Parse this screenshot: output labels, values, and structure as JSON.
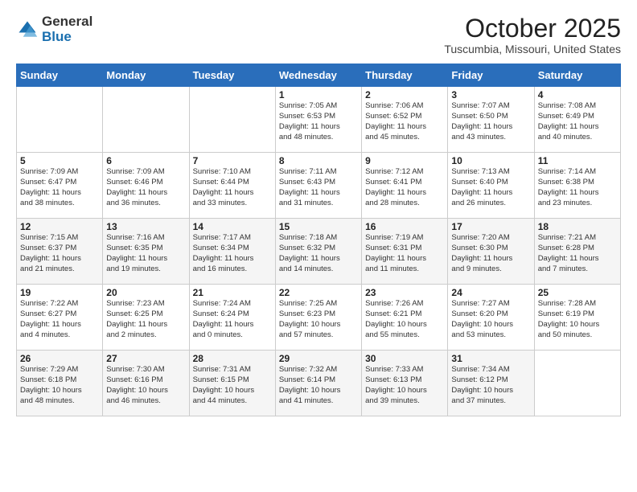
{
  "logo": {
    "general": "General",
    "blue": "Blue"
  },
  "header": {
    "month": "October 2025",
    "location": "Tuscumbia, Missouri, United States"
  },
  "weekdays": [
    "Sunday",
    "Monday",
    "Tuesday",
    "Wednesday",
    "Thursday",
    "Friday",
    "Saturday"
  ],
  "weeks": [
    [
      {
        "day": "",
        "info": ""
      },
      {
        "day": "",
        "info": ""
      },
      {
        "day": "",
        "info": ""
      },
      {
        "day": "1",
        "info": "Sunrise: 7:05 AM\nSunset: 6:53 PM\nDaylight: 11 hours\nand 48 minutes."
      },
      {
        "day": "2",
        "info": "Sunrise: 7:06 AM\nSunset: 6:52 PM\nDaylight: 11 hours\nand 45 minutes."
      },
      {
        "day": "3",
        "info": "Sunrise: 7:07 AM\nSunset: 6:50 PM\nDaylight: 11 hours\nand 43 minutes."
      },
      {
        "day": "4",
        "info": "Sunrise: 7:08 AM\nSunset: 6:49 PM\nDaylight: 11 hours\nand 40 minutes."
      }
    ],
    [
      {
        "day": "5",
        "info": "Sunrise: 7:09 AM\nSunset: 6:47 PM\nDaylight: 11 hours\nand 38 minutes."
      },
      {
        "day": "6",
        "info": "Sunrise: 7:09 AM\nSunset: 6:46 PM\nDaylight: 11 hours\nand 36 minutes."
      },
      {
        "day": "7",
        "info": "Sunrise: 7:10 AM\nSunset: 6:44 PM\nDaylight: 11 hours\nand 33 minutes."
      },
      {
        "day": "8",
        "info": "Sunrise: 7:11 AM\nSunset: 6:43 PM\nDaylight: 11 hours\nand 31 minutes."
      },
      {
        "day": "9",
        "info": "Sunrise: 7:12 AM\nSunset: 6:41 PM\nDaylight: 11 hours\nand 28 minutes."
      },
      {
        "day": "10",
        "info": "Sunrise: 7:13 AM\nSunset: 6:40 PM\nDaylight: 11 hours\nand 26 minutes."
      },
      {
        "day": "11",
        "info": "Sunrise: 7:14 AM\nSunset: 6:38 PM\nDaylight: 11 hours\nand 23 minutes."
      }
    ],
    [
      {
        "day": "12",
        "info": "Sunrise: 7:15 AM\nSunset: 6:37 PM\nDaylight: 11 hours\nand 21 minutes."
      },
      {
        "day": "13",
        "info": "Sunrise: 7:16 AM\nSunset: 6:35 PM\nDaylight: 11 hours\nand 19 minutes."
      },
      {
        "day": "14",
        "info": "Sunrise: 7:17 AM\nSunset: 6:34 PM\nDaylight: 11 hours\nand 16 minutes."
      },
      {
        "day": "15",
        "info": "Sunrise: 7:18 AM\nSunset: 6:32 PM\nDaylight: 11 hours\nand 14 minutes."
      },
      {
        "day": "16",
        "info": "Sunrise: 7:19 AM\nSunset: 6:31 PM\nDaylight: 11 hours\nand 11 minutes."
      },
      {
        "day": "17",
        "info": "Sunrise: 7:20 AM\nSunset: 6:30 PM\nDaylight: 11 hours\nand 9 minutes."
      },
      {
        "day": "18",
        "info": "Sunrise: 7:21 AM\nSunset: 6:28 PM\nDaylight: 11 hours\nand 7 minutes."
      }
    ],
    [
      {
        "day": "19",
        "info": "Sunrise: 7:22 AM\nSunset: 6:27 PM\nDaylight: 11 hours\nand 4 minutes."
      },
      {
        "day": "20",
        "info": "Sunrise: 7:23 AM\nSunset: 6:25 PM\nDaylight: 11 hours\nand 2 minutes."
      },
      {
        "day": "21",
        "info": "Sunrise: 7:24 AM\nSunset: 6:24 PM\nDaylight: 11 hours\nand 0 minutes."
      },
      {
        "day": "22",
        "info": "Sunrise: 7:25 AM\nSunset: 6:23 PM\nDaylight: 10 hours\nand 57 minutes."
      },
      {
        "day": "23",
        "info": "Sunrise: 7:26 AM\nSunset: 6:21 PM\nDaylight: 10 hours\nand 55 minutes."
      },
      {
        "day": "24",
        "info": "Sunrise: 7:27 AM\nSunset: 6:20 PM\nDaylight: 10 hours\nand 53 minutes."
      },
      {
        "day": "25",
        "info": "Sunrise: 7:28 AM\nSunset: 6:19 PM\nDaylight: 10 hours\nand 50 minutes."
      }
    ],
    [
      {
        "day": "26",
        "info": "Sunrise: 7:29 AM\nSunset: 6:18 PM\nDaylight: 10 hours\nand 48 minutes."
      },
      {
        "day": "27",
        "info": "Sunrise: 7:30 AM\nSunset: 6:16 PM\nDaylight: 10 hours\nand 46 minutes."
      },
      {
        "day": "28",
        "info": "Sunrise: 7:31 AM\nSunset: 6:15 PM\nDaylight: 10 hours\nand 44 minutes."
      },
      {
        "day": "29",
        "info": "Sunrise: 7:32 AM\nSunset: 6:14 PM\nDaylight: 10 hours\nand 41 minutes."
      },
      {
        "day": "30",
        "info": "Sunrise: 7:33 AM\nSunset: 6:13 PM\nDaylight: 10 hours\nand 39 minutes."
      },
      {
        "day": "31",
        "info": "Sunrise: 7:34 AM\nSunset: 6:12 PM\nDaylight: 10 hours\nand 37 minutes."
      },
      {
        "day": "",
        "info": ""
      }
    ]
  ]
}
